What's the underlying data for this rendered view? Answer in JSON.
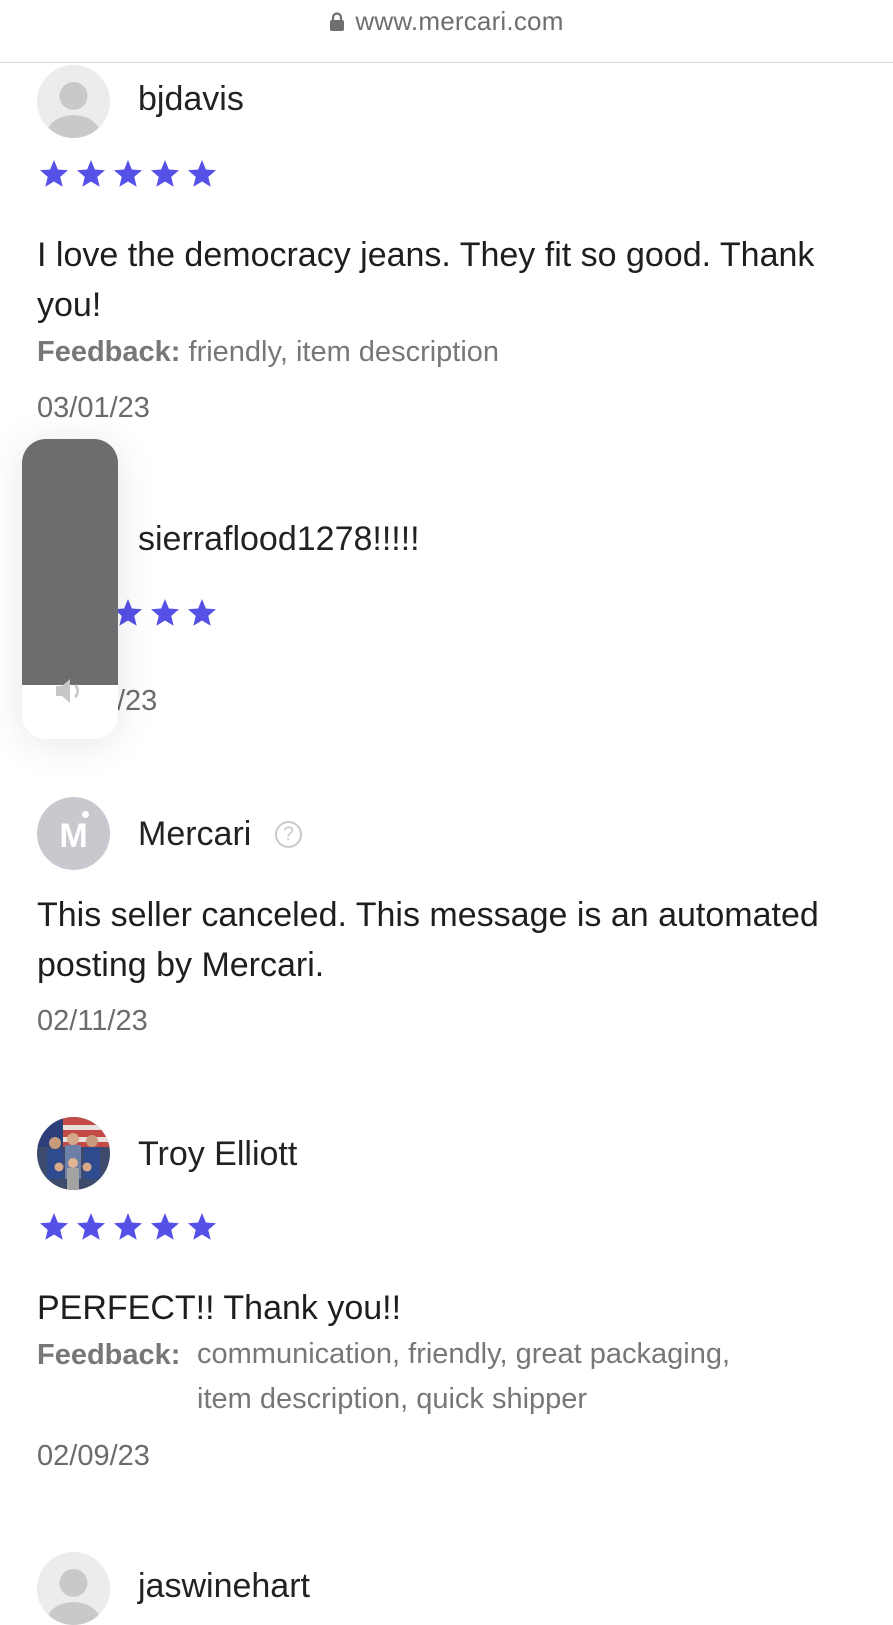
{
  "browser": {
    "url": "www.mercari.com"
  },
  "feedback_label": "Feedback:",
  "reviews": [
    {
      "username": "bjdavis",
      "stars": 5,
      "text": "I love the democracy jeans. They fit so good. Thank you!",
      "feedback": "friendly, item description",
      "date": "03/01/23"
    },
    {
      "username": "sierraflood1278!!!!!",
      "stars": 5,
      "date": "/23"
    },
    {
      "username": "Mercari",
      "avatar_letter": "M",
      "help_icon": "?",
      "text": "This seller canceled. This message is an automated posting by Mercari.",
      "date": "02/11/23"
    },
    {
      "username": "Troy Elliott",
      "stars": 5,
      "text": "PERFECT!! Thank you!!",
      "feedback_line1": "communication, friendly, great packaging,",
      "feedback_line2": "item description, quick shipper",
      "date": "02/09/23"
    },
    {
      "username": "jaswinehart"
    }
  ],
  "volume_overlay": {
    "icon": "speaker-icon",
    "level": 0.82
  },
  "colors": {
    "star": "#5651e6",
    "mercari_avatar": "#c8c9ce",
    "hud_fill": "#6d6d70"
  }
}
